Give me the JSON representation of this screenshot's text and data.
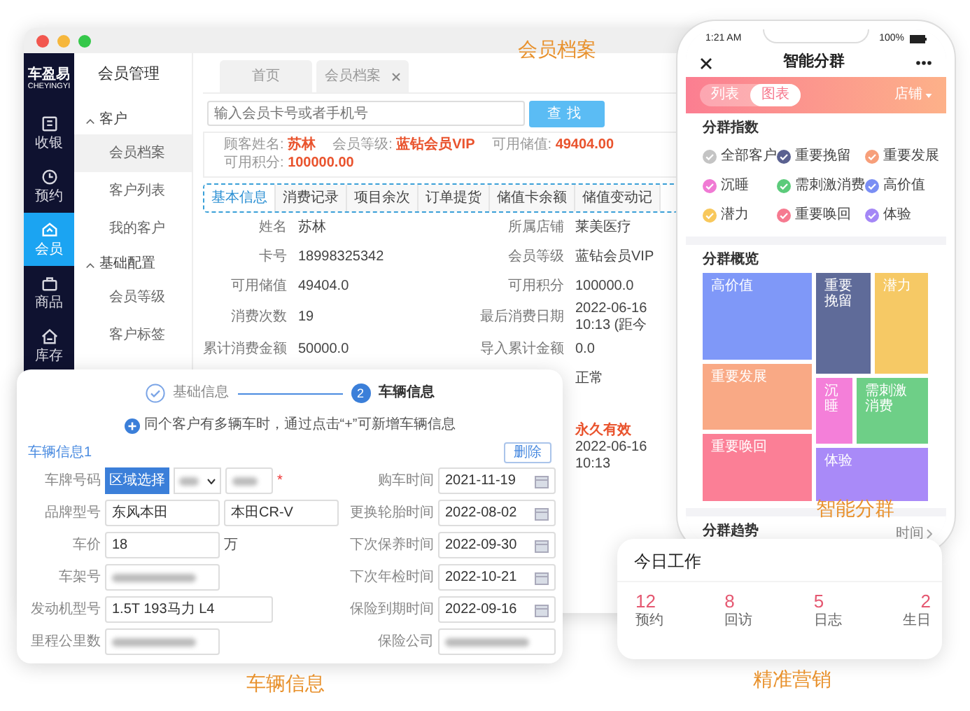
{
  "main_window": {
    "caption": "会员档案",
    "brand": {
      "name": "车盈易",
      "subtitle": "CHEYINGYI"
    },
    "nav": [
      {
        "label": "收银",
        "kind": "register",
        "selected": false
      },
      {
        "label": "预约",
        "kind": "clock",
        "selected": false
      },
      {
        "label": "会员",
        "kind": "crown",
        "selected": true
      },
      {
        "label": "商品",
        "kind": "bag",
        "selected": false
      },
      {
        "label": "库存",
        "kind": "house",
        "selected": false
      }
    ],
    "menu_title": "会员管理",
    "menu": [
      {
        "label": "客户",
        "expanded": true,
        "children": [
          {
            "label": "会员档案",
            "selected": true
          },
          {
            "label": "客户列表",
            "selected": false
          },
          {
            "label": "我的客户",
            "selected": false
          }
        ]
      },
      {
        "label": "基础配置",
        "expanded": true,
        "children": [
          {
            "label": "会员等级",
            "selected": false
          },
          {
            "label": "客户标签",
            "selected": false
          }
        ]
      }
    ],
    "page_tabs": [
      {
        "label": "首页",
        "closable": false
      },
      {
        "label": "会员档案",
        "closable": true
      }
    ],
    "search": {
      "placeholder": "输入会员卡号或者手机号",
      "button": "查找"
    },
    "summary": [
      {
        "label": "顾客姓名:",
        "value": "苏林"
      },
      {
        "label": "会员等级:",
        "value": "蓝钻会员VIP"
      },
      {
        "label": "可用储值:",
        "value": "49404.00"
      },
      {
        "label": "可用积分:",
        "value": "100000.00"
      }
    ],
    "tabs": [
      {
        "label": "基本信息",
        "selected": true
      },
      {
        "label": "消费记录",
        "selected": false
      },
      {
        "label": "项目余次",
        "selected": false
      },
      {
        "label": "订单提货",
        "selected": false
      },
      {
        "label": "储值卡余额",
        "selected": false
      },
      {
        "label": "储值变动记",
        "selected": false
      }
    ],
    "details_left": [
      {
        "label": "姓名",
        "value": "苏林"
      },
      {
        "label": "卡号",
        "value": "18998325342"
      },
      {
        "label": "可用储值",
        "value": "49404.0"
      },
      {
        "label": "消费次数",
        "value": "19"
      },
      {
        "label": "累计消费金额",
        "value": "50000.0"
      }
    ],
    "details_right": [
      {
        "label": "所属店铺",
        "value": "莱美医疗"
      },
      {
        "label": "会员等级",
        "value": "蓝钻会员VIP"
      },
      {
        "label": "可用积分",
        "value": "100000.0"
      },
      {
        "label": "最后消费日期",
        "value": "2022-06-16 10:13 (距今"
      },
      {
        "label": "导入累计金额",
        "value": "0.0"
      }
    ],
    "details_right_more": [
      {
        "value": "正常",
        "highlight": false
      },
      {
        "value": "永久有效",
        "highlight": true
      },
      {
        "value": "2022-06-16 10:13",
        "highlight": false
      }
    ]
  },
  "vehicle_form": {
    "caption": "车辆信息",
    "steps": [
      {
        "label": "基础信息",
        "done": true
      },
      {
        "label": "车辆信息",
        "done": false,
        "number": "2"
      }
    ],
    "hint": "同个客户有多辆车时，通过点击“+”可新增车辆信息",
    "title": "车辆信息1",
    "delete_button": "删除",
    "fields_left": [
      {
        "label": "车牌号码",
        "kind": "plate",
        "button": "区域选择",
        "required_mark": "*"
      },
      {
        "label": "品牌型号",
        "kind": "pair",
        "values": [
          "东风本田",
          "本田CR-V"
        ]
      },
      {
        "label": "车价",
        "kind": "unit",
        "value": "18",
        "unit": "万"
      },
      {
        "label": "车架号",
        "kind": "masked"
      },
      {
        "label": "发动机型号",
        "kind": "text",
        "value": "1.5T 193马力 L4"
      },
      {
        "label": "里程公里数",
        "kind": "masked"
      }
    ],
    "fields_right": [
      {
        "label": "购车时间",
        "kind": "date",
        "value": "2021-11-19"
      },
      {
        "label": "更换轮胎时间",
        "kind": "date",
        "value": "2022-08-02"
      },
      {
        "label": "下次保养时间",
        "kind": "date",
        "value": "2022-09-30"
      },
      {
        "label": "下次年检时间",
        "kind": "date",
        "value": "2022-10-21"
      },
      {
        "label": "保险到期时间",
        "kind": "date",
        "value": "2022-09-16"
      },
      {
        "label": "保险公司",
        "kind": "masked"
      }
    ]
  },
  "phone": {
    "caption": "智能分群",
    "status": {
      "time": "1:21 AM",
      "battery": "100%"
    },
    "title": "智能分群",
    "views": [
      {
        "label": "列表",
        "selected": false
      },
      {
        "label": "图表",
        "selected": true
      }
    ],
    "store_filter": "店铺",
    "index_title": "分群指数",
    "groups": [
      {
        "label": "全部客户",
        "color": "#c4c4c4",
        "checked": true
      },
      {
        "label": "重要挽留",
        "color": "#5a6190",
        "checked": true
      },
      {
        "label": "重要发展",
        "color": "#f79f7a",
        "checked": true
      },
      {
        "label": "沉睡",
        "color": "#f07ad4",
        "checked": true
      },
      {
        "label": "需刺激消费",
        "color": "#5ccb7b",
        "checked": true
      },
      {
        "label": "高价值",
        "color": "#7a8ef4",
        "checked": true
      },
      {
        "label": "潜力",
        "color": "#f8c85c",
        "checked": true
      },
      {
        "label": "重要唤回",
        "color": "#f67a90",
        "checked": true
      },
      {
        "label": "体验",
        "color": "#a487f6",
        "checked": true
      }
    ],
    "overview_title": "分群概览",
    "segments": [
      {
        "label": "高价值",
        "color": "#7f98f8"
      },
      {
        "label": "重要挽留",
        "color": "#5f6b99"
      },
      {
        "label": "潜力",
        "color": "#f6c965"
      },
      {
        "label": "重要发展",
        "color": "#f9a985"
      },
      {
        "label": "沉睡",
        "color": "#f47fd9"
      },
      {
        "label": "需刺激消费",
        "color": "#6ecf87"
      },
      {
        "label": "重要唤回",
        "color": "#fb7f96"
      },
      {
        "label": "体验",
        "color": "#a98af8"
      }
    ],
    "trend_title": "分群趋势",
    "trend_filter": "时间"
  },
  "today": {
    "caption": "精准营销",
    "title": "今日工作",
    "stats": [
      {
        "value": "12",
        "label": "预约"
      },
      {
        "value": "8",
        "label": "回访"
      },
      {
        "value": "5",
        "label": "日志"
      },
      {
        "value": "2",
        "label": "生日"
      }
    ]
  }
}
